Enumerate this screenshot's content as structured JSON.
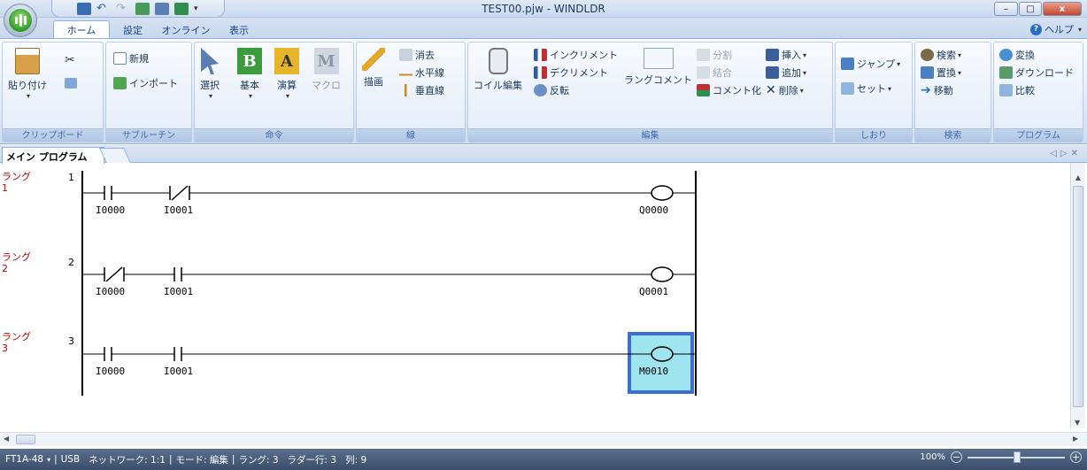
{
  "window": {
    "title": "TEST00.pjw - WINDLDR",
    "min": "–",
    "max": "□",
    "close": "x"
  },
  "tabs": [
    "ホーム",
    "設定",
    "オンライン",
    "表示"
  ],
  "help": "ヘルプ",
  "ribbon": {
    "clipboard": {
      "label": "クリップボード",
      "paste": "貼り付け"
    },
    "subroutine": {
      "label": "サブルーチン",
      "new": "新規",
      "import": "インポート"
    },
    "instruction": {
      "label": "命令",
      "select": "選択",
      "basic": "基本",
      "calc": "演算",
      "macro": "マクロ"
    },
    "line": {
      "label": "線",
      "draw": "描画",
      "erase": "消去",
      "hline": "水平線",
      "vline": "垂直線"
    },
    "edit": {
      "label": "編集",
      "coil": "コイル編集",
      "inc": "インクリメント",
      "dec": "デクリメント",
      "invert": "反転",
      "rung_comment": "ラングコメント",
      "split": "分割",
      "join": "結合",
      "comment_out": "コメント化",
      "insert": "挿入",
      "add": "追加",
      "delete": "削除"
    },
    "bookmark": {
      "label": "しおり",
      "jump": "ジャンプ",
      "set": "セット"
    },
    "search": {
      "label": "検索",
      "find": "検索",
      "replace": "置換",
      "move": "移動"
    },
    "program": {
      "label": "プログラム",
      "convert": "変換",
      "download": "ダウンロード",
      "compare": "比較"
    }
  },
  "doc_tab": "メイン プログラム",
  "rungs": [
    {
      "label": "ラング",
      "num": "1",
      "idx": "1",
      "contacts": [
        "I0000",
        "I0001"
      ],
      "coil": "Q0000"
    },
    {
      "label": "ラング",
      "num": "2",
      "idx": "2",
      "contacts": [
        "I0000",
        "I0001"
      ],
      "coil": "Q0001"
    },
    {
      "label": "ラング",
      "num": "3",
      "idx": "3",
      "contacts": [
        "I0000",
        "I0001"
      ],
      "coil": "M0010"
    }
  ],
  "status": {
    "plc": "FT1A-48",
    "conn": "USB",
    "network": "ネットワーク: 1:1",
    "mode": "モード: 編集",
    "rung": "ラング: 3",
    "ladder_row": "ラダー行: 3",
    "col": "列: 9",
    "zoom": "100%"
  }
}
